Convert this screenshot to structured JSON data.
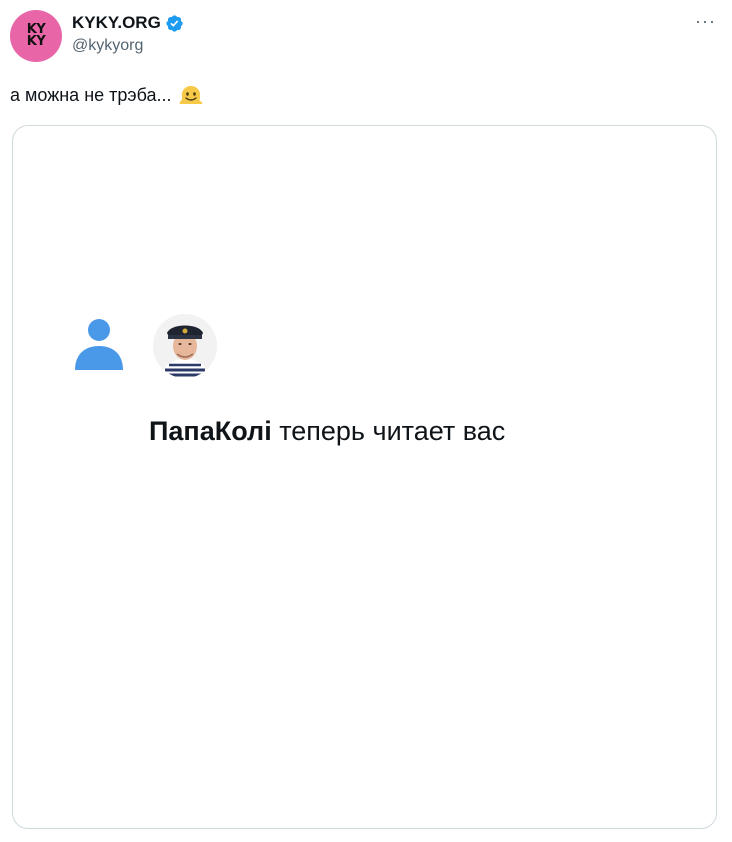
{
  "tweet": {
    "author": {
      "avatar_text_top": "KY",
      "avatar_text_bottom": "KY",
      "display_name": "KYKY.ORG",
      "handle": "@kykyorg",
      "verified": true,
      "avatar_color": "#e866a8"
    },
    "more_label": "···",
    "text": "а можна не трэба...",
    "emoji": "melting-face-icon"
  },
  "media": {
    "follower_name": "ПапаКолі",
    "follow_message": " теперь читает вас",
    "person_icon_color": "#4a99e9"
  },
  "colors": {
    "verified_badge": "#1d9bf0",
    "border": "#cfd9de",
    "secondary_text": "#536471"
  }
}
